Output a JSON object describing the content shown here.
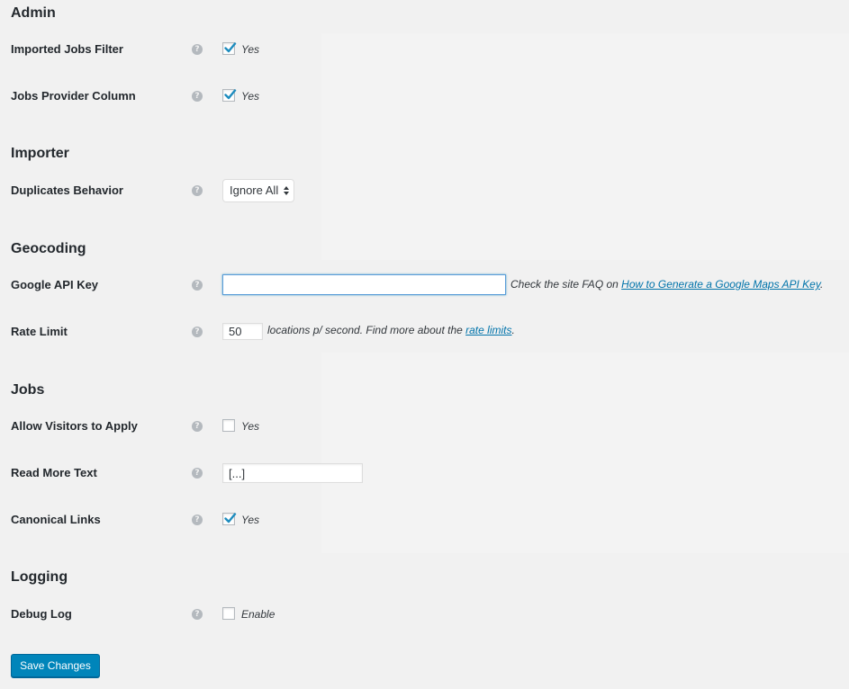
{
  "sections": {
    "admin": {
      "title": "Admin",
      "imported_jobs_filter": {
        "label": "Imported Jobs Filter",
        "checked": true,
        "option_label": "Yes"
      },
      "jobs_provider_column": {
        "label": "Jobs Provider Column",
        "checked": true,
        "option_label": "Yes"
      }
    },
    "importer": {
      "title": "Importer",
      "duplicates_behavior": {
        "label": "Duplicates Behavior",
        "selected": "Ignore All"
      }
    },
    "geocoding": {
      "title": "Geocoding",
      "google_api_key": {
        "label": "Google API Key",
        "value": "",
        "desc_prefix": "Check the site FAQ on ",
        "desc_link": "How to Generate a Google Maps API Key",
        "desc_suffix": "."
      },
      "rate_limit": {
        "label": "Rate Limit",
        "value": "50",
        "desc_prefix": "locations p/ second. Find more about the ",
        "desc_link": "rate limits",
        "desc_suffix": "."
      }
    },
    "jobs": {
      "title": "Jobs",
      "allow_visitors_to_apply": {
        "label": "Allow Visitors to Apply",
        "checked": false,
        "option_label": "Yes"
      },
      "read_more_text": {
        "label": "Read More Text",
        "value": "[...]"
      },
      "canonical_links": {
        "label": "Canonical Links",
        "checked": true,
        "option_label": "Yes"
      }
    },
    "logging": {
      "title": "Logging",
      "debug_log": {
        "label": "Debug Log",
        "checked": false,
        "option_label": "Enable"
      }
    }
  },
  "help_icon_glyph": "?",
  "save_button": {
    "label": "Save Changes"
  },
  "colors": {
    "accent": "#0085ba",
    "link": "#0073aa",
    "checkmark": "#1e8cbe",
    "background": "#f1f1f1"
  }
}
